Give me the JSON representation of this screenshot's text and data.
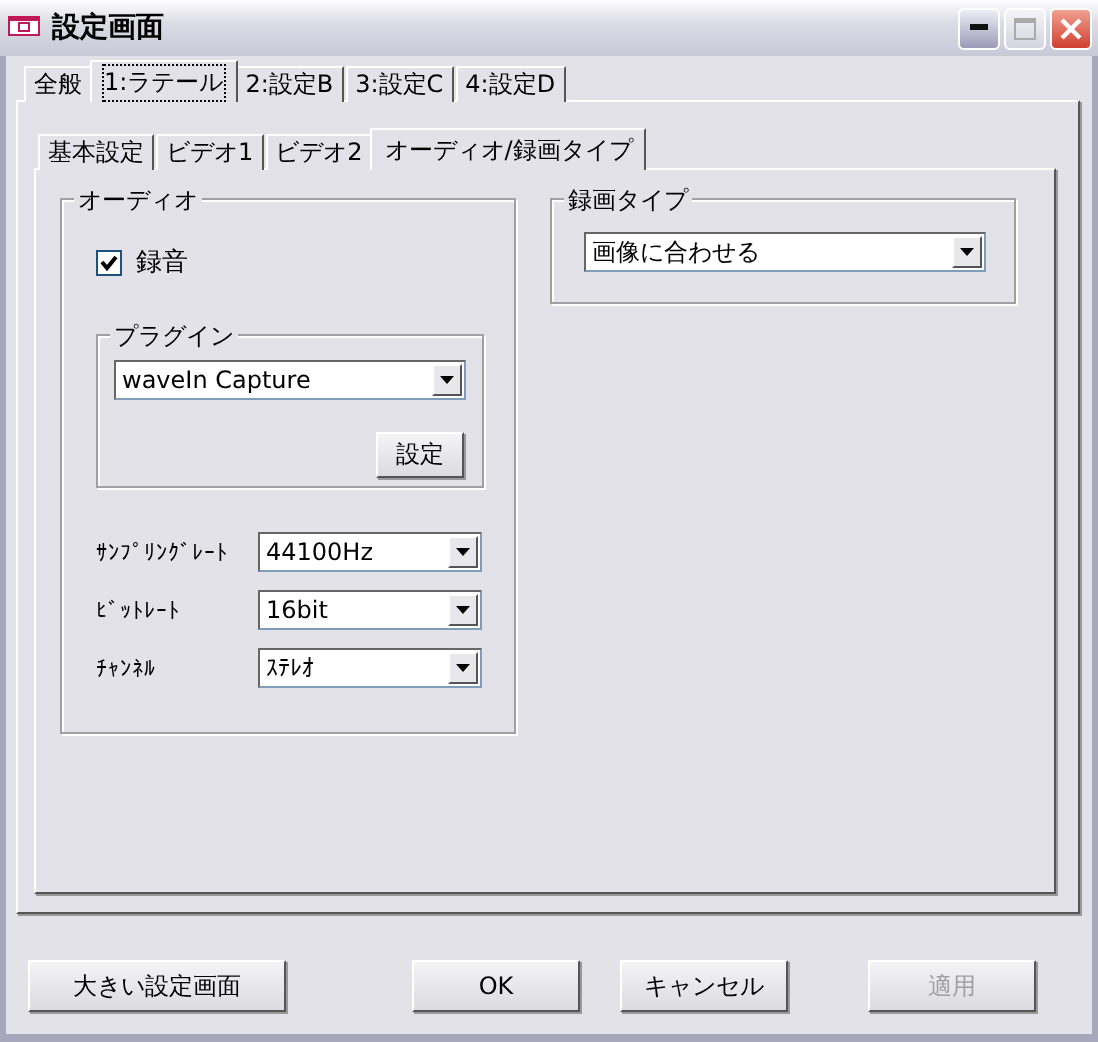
{
  "window": {
    "title": "設定画面"
  },
  "tabs": [
    {
      "label": "全般",
      "selected": false
    },
    {
      "label": "1:ラテール",
      "selected": true
    },
    {
      "label": "2:設定B",
      "selected": false
    },
    {
      "label": "3:設定C",
      "selected": false
    },
    {
      "label": "4:設定D",
      "selected": false
    }
  ],
  "subtabs": [
    {
      "label": "基本設定",
      "selected": false
    },
    {
      "label": "ビデオ1",
      "selected": false
    },
    {
      "label": "ビデオ2",
      "selected": false
    },
    {
      "label": "オーディオ/録画タイプ",
      "selected": true
    }
  ],
  "audio": {
    "title": "オーディオ",
    "record": {
      "label": "録音",
      "checked": true
    },
    "plugin": {
      "title": "プラグイン",
      "value": "waveIn Capture",
      "button": "設定"
    },
    "fields": [
      {
        "label": "ｻﾝﾌﾟﾘﾝｸﾞﾚｰﾄ",
        "value": "44100Hz"
      },
      {
        "label": "ﾋﾞｯﾄﾚｰﾄ",
        "value": "16bit"
      },
      {
        "label": "ﾁｬﾝﾈﾙ",
        "value": "ｽﾃﾚｵ"
      }
    ]
  },
  "recording_type": {
    "title": "録画タイプ",
    "value": "画像に合わせる"
  },
  "buttons": [
    {
      "label": "大きい設定画面",
      "disabled": false
    },
    {
      "label": "OK",
      "disabled": false
    },
    {
      "label": "キャンセル",
      "disabled": false
    },
    {
      "label": "適用",
      "disabled": true
    }
  ]
}
